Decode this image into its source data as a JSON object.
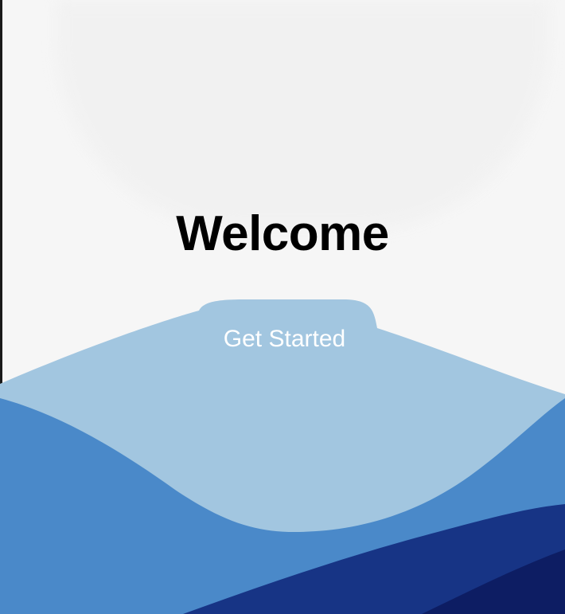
{
  "screen": {
    "title": "Welcome",
    "primary_action_label": "Get Started"
  },
  "colors": {
    "background": "#f6f6f6",
    "wave_light": "#a2c6e0",
    "wave_medium": "#4a89c9",
    "wave_dark": "#173485",
    "wave_darkest": "#0d1d63",
    "title": "#000000",
    "button_text": "#ffffff"
  }
}
